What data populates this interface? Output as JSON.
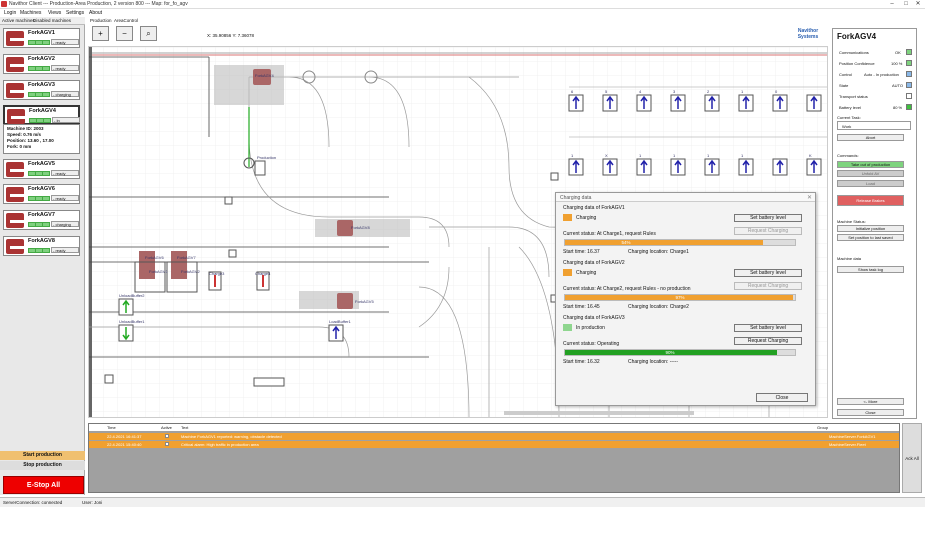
{
  "window": {
    "title": "Navithor Client --- Production-Area Production, 2 version 800 --- Map: for_fo_agv"
  },
  "menu": [
    "Login",
    "Machines",
    "Views",
    "Settings",
    "About"
  ],
  "left_tabs": [
    "Active machines",
    "Disabled machines"
  ],
  "machines": [
    {
      "name": "ForkAGV1",
      "status": "- ready"
    },
    {
      "name": "ForkAGV2",
      "status": "- ready"
    },
    {
      "name": "ForkAGV3",
      "status": "- charging"
    },
    {
      "name": "ForkAGV4",
      "status": "- In production"
    },
    {
      "name": "ForkAGV5",
      "status": "- ready"
    },
    {
      "name": "ForkAGV6",
      "status": "- ready"
    },
    {
      "name": "ForkAGV7",
      "status": "- charging"
    },
    {
      "name": "ForkAGV8",
      "status": "- ready"
    }
  ],
  "details": {
    "machine_id": "Machine ID: 2003",
    "speed": "Speed: 0.76 m/s",
    "position": "Position: 13.60 , 17.00",
    "fork": "Fork: 0 mm"
  },
  "buttons": {
    "start": "Start production",
    "stop": "Stop production",
    "estop": "E-Stop All"
  },
  "statusbar": {
    "server": "ServerConnection: connected",
    "user": "User: Joni"
  },
  "map_tabs": [
    "Production",
    "AreaControl"
  ],
  "toolbar": {
    "zoom_in": "+",
    "zoom_out": "−",
    "zoom_fit": "⌕",
    "coords": "X: 35.90856  Y: 7.36078"
  },
  "logo": {
    "line1": "Navithor",
    "line2": "Systems"
  },
  "map_labels": {
    "charge": [
      "ForkAGV1",
      "ForkAGV2",
      "Charge3",
      "Charge4"
    ],
    "unloadbuffer": [
      "UnloadBuffer2",
      "UnloadBuffer1"
    ],
    "loadbuffer": "LoadBuffer1",
    "production": "Production",
    "agv": [
      "ForkAGV4",
      "ForkAGV8",
      "ForkAGV5",
      "ForkAGV6",
      "ForkAGV7"
    ],
    "top_nums": [
      "6",
      "5",
      "4",
      "3",
      "2",
      "1",
      "0"
    ],
    "bot_nums": [
      "1",
      "X",
      "1",
      "1",
      "1",
      "1",
      "K"
    ]
  },
  "right": {
    "title": "ForkAGV4",
    "rows": [
      {
        "label": "Communications",
        "value": "OK",
        "color": "#7ed37e"
      },
      {
        "label": "Position Confidence",
        "value": "100 %",
        "color": "#7ed37e"
      },
      {
        "label": "Control",
        "value": "Auto - In production",
        "color": "#8ab8e8"
      },
      {
        "label": "State",
        "value": "AUTO",
        "color": "#8ab8e8"
      },
      {
        "label": "Transport status",
        "value": "",
        "color": "#ffffff"
      },
      {
        "label": "Battery level",
        "value": "80 %",
        "color": "#3fbf3f"
      }
    ],
    "current_task_label": "Current Task:",
    "current_task": "Work",
    "abort": "Abort",
    "commands_label": "Commands:",
    "cmd_take_out": "Take out of production",
    "cmd_unfold": "Unfold AV",
    "cmd_load": "Load",
    "cmd_release_brakes": "Release Brakes",
    "machine_status_label": "Machine Status:",
    "initialize_position": "Initialize position",
    "set_position_last": "Set position to last saved",
    "machine_data_label": "Machine data",
    "show_task_log": "Show task log",
    "more": "<- More",
    "close": "Close"
  },
  "dialog": {
    "title": "Charging data",
    "sections": [
      {
        "heading": "Charging data of ForkAGV1",
        "state": "Charging",
        "state_color": "#f0a030",
        "status": "Current status: At Charge1, request Rules",
        "progress": 0.54,
        "progress_label": "54%",
        "bar_color": "#f0a030",
        "start": "Start time: 16.37",
        "location": "Charging location: Charge1",
        "set_btn": "Set battery level",
        "req_btn": "Request Charging",
        "req_enabled": false
      },
      {
        "heading": "Charging data of ForkAGV2",
        "state": "Charging",
        "state_color": "#f0a030",
        "status": "Current status: At Charge2, request Rules - no production",
        "progress": 0.97,
        "progress_label": "97%",
        "bar_color": "#f0a030",
        "start": "Start time: 16.45",
        "location": "Charging location: Charge2",
        "set_btn": "Set battery level",
        "req_btn": "Request Charging",
        "req_enabled": false
      },
      {
        "heading": "Charging data of ForkAGV3",
        "state": "In production",
        "state_color": "#8fd68f",
        "status": "Current status: Operating",
        "progress": 0.9,
        "progress_label": "90%",
        "bar_color": "#22a022",
        "start": "Start time: 16.32",
        "location": "Charging location: -----",
        "set_btn": "Set battery level",
        "req_btn": "Request Charging",
        "req_enabled": true
      }
    ],
    "close": "Close"
  },
  "log": {
    "headers": [
      "Time",
      "Active",
      "Text",
      "Group"
    ],
    "rows": [
      {
        "time": "22.4.2021 16:41:37",
        "text": "Machine ForkAGV1 reported: warning, obstacle detected",
        "group": "MachineServer.ForkAGV1"
      },
      {
        "time": "22.4.2021 15:40:40",
        "text": "Critical alarm: High traffic in production area",
        "group": "MachineServer.Fleet"
      }
    ],
    "ack_all": "Ack All"
  }
}
